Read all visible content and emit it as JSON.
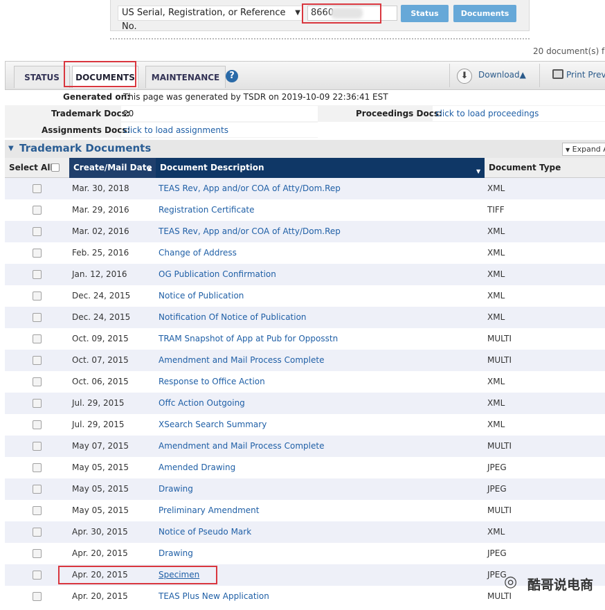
{
  "search": {
    "type_select": "US Serial, Registration, or Reference No.",
    "serial_value": "8660",
    "status_btn": "Status",
    "documents_btn": "Documents"
  },
  "doc_count": "20 document(s) f",
  "tabs": {
    "status": "STATUS",
    "documents": "DOCUMENTS",
    "maintenance": "MAINTENANCE",
    "help": "?"
  },
  "toolbar": {
    "download": "Download▲",
    "print": "Print Previ"
  },
  "info": {
    "generated_label": "Generated on:",
    "generated_value": "This page was generated by TSDR on 2019-10-09 22:36:41 EST",
    "tm_docs_label": "Trademark Docs:",
    "tm_docs_value": "20",
    "proceedings_label": "Proceedings Docs:",
    "proceedings_value": "click to load proceedings",
    "assignments_label": "Assignments Docs:",
    "assignments_value": "click to load assignments"
  },
  "section": {
    "title": "Trademark Documents",
    "expand": "Expand A"
  },
  "table": {
    "columns": [
      "Select All",
      "Create/Mail Date",
      "Document Description",
      "Document Type"
    ],
    "rows": [
      {
        "date": "Mar. 30, 2018",
        "desc": "TEAS Rev, App and/or COA of Atty/Dom.Rep",
        "type": "XML"
      },
      {
        "date": "Mar. 29, 2016",
        "desc": "Registration Certificate",
        "type": "TIFF"
      },
      {
        "date": "Mar. 02, 2016",
        "desc": "TEAS Rev, App and/or COA of Atty/Dom.Rep",
        "type": "XML"
      },
      {
        "date": "Feb. 25, 2016",
        "desc": "Change of Address",
        "type": "XML"
      },
      {
        "date": "Jan. 12, 2016",
        "desc": "OG Publication Confirmation",
        "type": "XML"
      },
      {
        "date": "Dec. 24, 2015",
        "desc": "Notice of Publication",
        "type": "XML"
      },
      {
        "date": "Dec. 24, 2015",
        "desc": "Notification Of Notice of Publication",
        "type": "XML"
      },
      {
        "date": "Oct. 09, 2015",
        "desc": "TRAM Snapshot of App at Pub for Opposstn",
        "type": "MULTI"
      },
      {
        "date": "Oct. 07, 2015",
        "desc": "Amendment and Mail Process Complete",
        "type": "MULTI"
      },
      {
        "date": "Oct. 06, 2015",
        "desc": "Response to Office Action",
        "type": "XML"
      },
      {
        "date": "Jul. 29, 2015",
        "desc": "Offc Action Outgoing",
        "type": "XML"
      },
      {
        "date": "Jul. 29, 2015",
        "desc": "XSearch Search Summary",
        "type": "XML"
      },
      {
        "date": "May 07, 2015",
        "desc": "Amendment and Mail Process Complete",
        "type": "MULTI"
      },
      {
        "date": "May 05, 2015",
        "desc": "Amended Drawing",
        "type": "JPEG"
      },
      {
        "date": "May 05, 2015",
        "desc": "Drawing",
        "type": "JPEG"
      },
      {
        "date": "May 05, 2015",
        "desc": "Preliminary Amendment",
        "type": "MULTI"
      },
      {
        "date": "Apr. 30, 2015",
        "desc": "Notice of Pseudo Mark",
        "type": "XML"
      },
      {
        "date": "Apr. 20, 2015",
        "desc": "Drawing",
        "type": "JPEG"
      },
      {
        "date": "Apr. 20, 2015",
        "desc": "Specimen",
        "type": "JPEG"
      },
      {
        "date": "Apr. 20, 2015",
        "desc": "TEAS Plus New Application",
        "type": "MULTI"
      }
    ]
  },
  "watermark": "酷哥说电商",
  "colors": {
    "header_navy": "#0f3766",
    "link_blue": "#1f5fa6",
    "highlight_red": "#d9363e",
    "button_blue": "#66a8d8"
  }
}
